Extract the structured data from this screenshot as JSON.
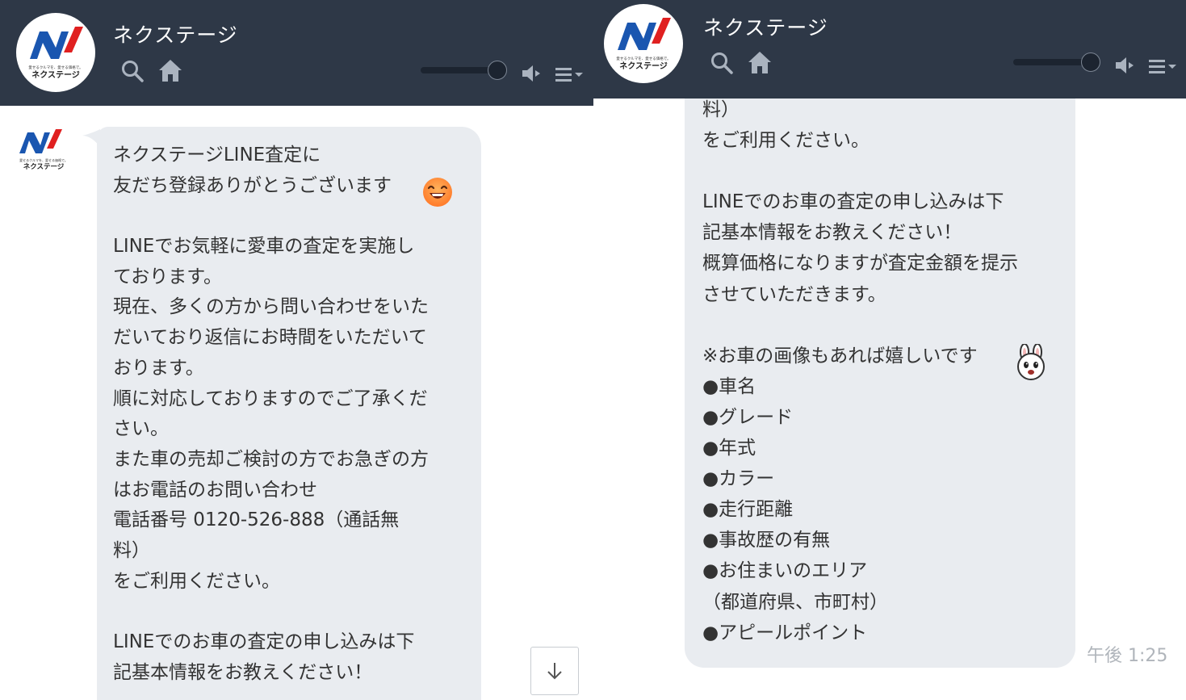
{
  "colors": {
    "header_bg": "#2e3847",
    "bubble_bg": "#e9ecf0",
    "text": "#333333",
    "timestamp": "#b0b5bb"
  },
  "logo": {
    "brand_text": "ネクステージ",
    "tagline": "愛せるクルマを、愛せる価格で。"
  },
  "left_panel": {
    "header": {
      "title": "ネクステージ",
      "icons": [
        "search-icon",
        "home-icon",
        "volume-slider",
        "speaker-icon",
        "menu-icon"
      ]
    },
    "message_lines": [
      "ネクステージLINE査定に",
      "友だち登録ありがとうございます",
      "",
      "LINEでお気軽に愛車の査定を実施し",
      "ております。",
      "現在、多くの方から問い合わせをいた",
      "だいており返信にお時間をいただいて",
      "おります。",
      "順に対応しておりますのでご了承くだ",
      "さい。",
      "また車の売却ご検討の方でお急ぎの方",
      "はお電話のお問い合わせ",
      "電話番号 0120-526-888（通話無",
      "料）",
      "をご利用ください。",
      "",
      "LINEでのお車の査定の申し込みは下",
      "記基本情報をお教えください！"
    ],
    "emoji": "smiling-face-emoji",
    "scroll_button": "arrow-down-icon"
  },
  "right_panel": {
    "header": {
      "title": "ネクステージ",
      "icons": [
        "search-icon",
        "home-icon",
        "volume-slider",
        "speaker-icon",
        "menu-icon"
      ]
    },
    "message_lines": [
      "料）",
      "をご利用ください。",
      "",
      "LINEでのお車の査定の申し込みは下",
      "記基本情報をお教えください！",
      "概算価格になりますが査定金額を提示",
      "させていただきます。",
      "",
      "※お車の画像もあれば嬉しいです",
      "●車名",
      "●グレード",
      "●年式",
      "●カラー",
      "●走行距離",
      "●事故歴の有無",
      "●お住まいのエリア",
      "（都道府県、市町村）",
      "●アピールポイント"
    ],
    "emoji": "rabbit-face-emoji",
    "timestamp": "午後 1:25"
  }
}
